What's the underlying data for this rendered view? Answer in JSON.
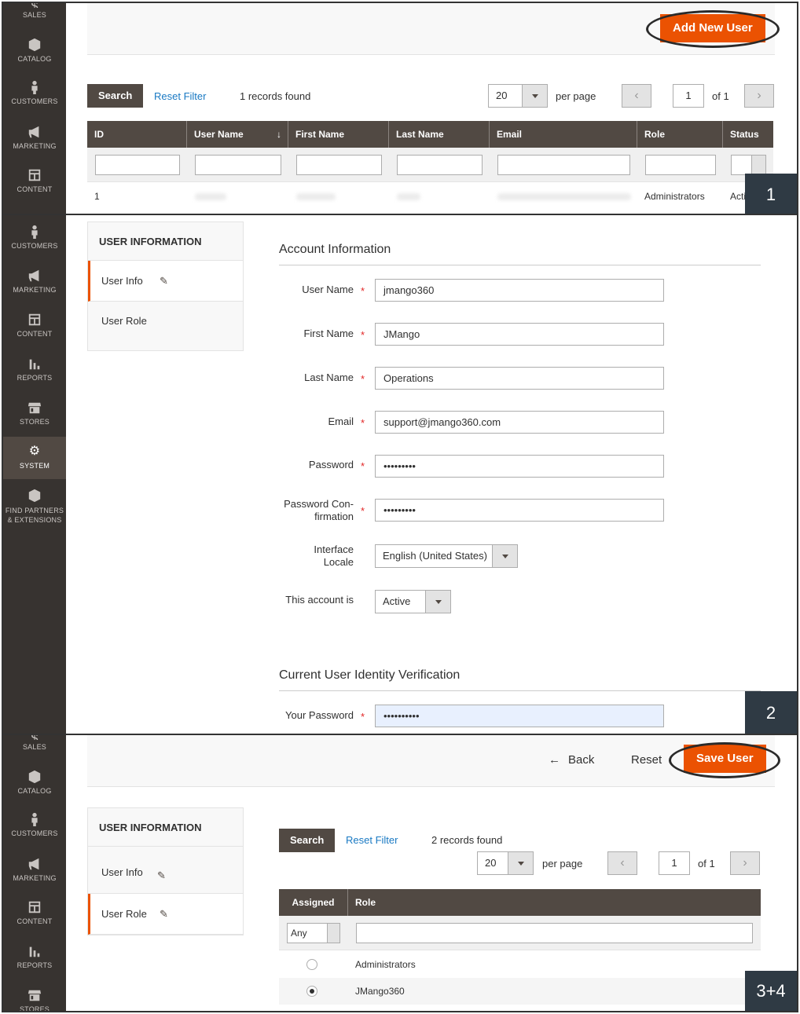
{
  "sidebar1": {
    "items": [
      {
        "label": "SALES",
        "icon": "dollar-icon"
      },
      {
        "label": "CATALOG",
        "icon": "cube-icon"
      },
      {
        "label": "CUSTOMERS",
        "icon": "person-icon"
      },
      {
        "label": "MARKETING",
        "icon": "megaphone-icon"
      },
      {
        "label": "CONTENT",
        "icon": "layout-icon"
      }
    ]
  },
  "panel1": {
    "add_new_user": "Add New User",
    "search": "Search",
    "reset_filter": "Reset Filter",
    "records_found": "1 records found",
    "per_page_value": "20",
    "per_page_label": "per page",
    "page_value": "1",
    "page_of": "of 1",
    "columns": [
      "ID",
      "User Name",
      "First Name",
      "Last Name",
      "Email",
      "Role",
      "Status"
    ],
    "sort_indicator": "↓",
    "row": {
      "id": "1",
      "role": "Administrators",
      "status": "Acti"
    },
    "step": "1"
  },
  "sidebar2": {
    "items": [
      {
        "label": "CUSTOMERS",
        "icon": "person-icon"
      },
      {
        "label": "MARKETING",
        "icon": "megaphone-icon"
      },
      {
        "label": "CONTENT",
        "icon": "layout-icon"
      },
      {
        "label": "REPORTS",
        "icon": "bar-chart-icon"
      },
      {
        "label": "STORES",
        "icon": "store-icon"
      },
      {
        "label": "SYSTEM",
        "icon": "gear-icon"
      },
      {
        "label_line1": "FIND PARTNERS",
        "label_line2": "& EXTENSIONS",
        "icon": "boxes-icon"
      }
    ]
  },
  "panel2": {
    "tabs_title": "USER INFORMATION",
    "tab_user_info": "User Info",
    "tab_user_role": "User Role",
    "account_title": "Account Information",
    "fields": {
      "username": {
        "label": "User Name",
        "value": "jmango360"
      },
      "firstname": {
        "label": "First Name",
        "value": "JMango"
      },
      "lastname": {
        "label": "Last Name",
        "value": "Operations"
      },
      "email": {
        "label": "Email",
        "value": "support@jmango360.com"
      },
      "password": {
        "label": "Password",
        "value": "•••••••••"
      },
      "password_conf": {
        "label_line1": "Password Con-",
        "label_line2": "firmation",
        "value": "•••••••••"
      },
      "locale": {
        "label_line1": "Interface",
        "label_line2": "Locale",
        "value": "English (United States)"
      },
      "active": {
        "label": "This account is",
        "value": "Active"
      }
    },
    "verification_title": "Current User Identity Verification",
    "your_password": {
      "label": "Your Password",
      "value": "••••••••••"
    },
    "step": "2"
  },
  "sidebar3": {
    "items": [
      {
        "label": "SALES",
        "icon": "dollar-icon"
      },
      {
        "label": "CATALOG",
        "icon": "cube-icon"
      },
      {
        "label": "CUSTOMERS",
        "icon": "person-icon"
      },
      {
        "label": "MARKETING",
        "icon": "megaphone-icon"
      },
      {
        "label": "CONTENT",
        "icon": "layout-icon"
      },
      {
        "label": "REPORTS",
        "icon": "bar-chart-icon"
      },
      {
        "label": "STORES",
        "icon": "store-icon"
      }
    ]
  },
  "panel3": {
    "back": "Back",
    "reset": "Reset",
    "save_user": "Save User",
    "tabs_title": "USER INFORMATION",
    "tab_user_info": "User Info",
    "tab_user_role": "User Role",
    "search": "Search",
    "reset_filter": "Reset Filter",
    "records_found": "2 records found",
    "per_page_value": "20",
    "per_page_label": "per page",
    "page_value": "1",
    "page_of": "of 1",
    "columns": [
      "Assigned",
      "Role"
    ],
    "assigned_filter": "Any",
    "roles": [
      {
        "name": "Administrators",
        "selected": false
      },
      {
        "name": "JMango360",
        "selected": true
      }
    ],
    "step": "3+4"
  },
  "colors": {
    "accent": "#eb5202",
    "sidebar": "#373330",
    "grid_header": "#514943",
    "link": "#1979c3"
  }
}
